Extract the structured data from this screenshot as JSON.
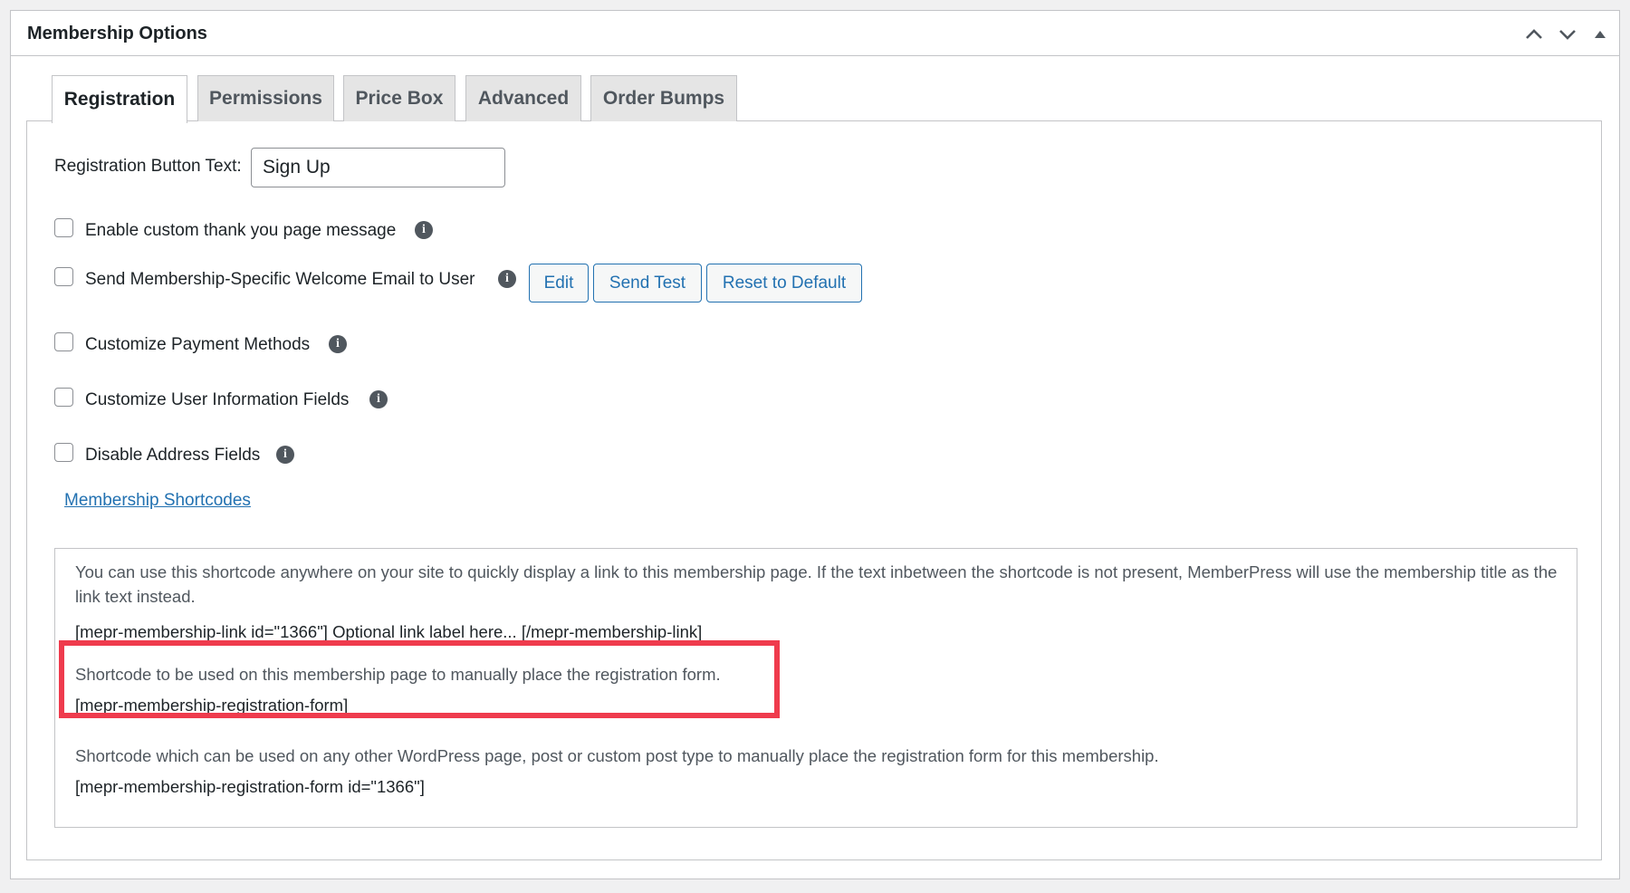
{
  "metabox": {
    "title": "Membership Options",
    "controls": [
      "chevron-up-icon",
      "chevron-down-icon",
      "triangle-up-icon"
    ]
  },
  "tabs": [
    {
      "label": "Registration",
      "active": true
    },
    {
      "label": "Permissions",
      "active": false
    },
    {
      "label": "Price Box",
      "active": false
    },
    {
      "label": "Advanced",
      "active": false
    },
    {
      "label": "Order Bumps",
      "active": false
    }
  ],
  "registration": {
    "button_text_label": "Registration Button Text:",
    "button_text_value": "Sign Up",
    "options": [
      {
        "label": "Enable custom thank you page message",
        "checked": false
      },
      {
        "label": "Send Membership-Specific Welcome Email to User",
        "checked": false
      },
      {
        "label": "Customize Payment Methods",
        "checked": false
      },
      {
        "label": "Customize User Information Fields",
        "checked": false
      },
      {
        "label": "Disable Address Fields",
        "checked": false
      }
    ],
    "email_buttons": {
      "edit": "Edit",
      "send_test": "Send Test",
      "reset": "Reset to Default"
    },
    "info_icon_glyph": "i",
    "shortcodes_link": "Membership Shortcodes"
  },
  "shortcodes": {
    "link_desc": "You can use this shortcode anywhere on your site to quickly display a link to this membership page. If the text inbetween the shortcode is not present, MemberPress will use the membership title as the link text instead.",
    "link_code": "[mepr-membership-link id=\"1366\"] Optional link label here... [/mepr-membership-link]",
    "page_desc": "Shortcode to be used on this membership page to manually place the registration form.",
    "page_code": "[mepr-membership-registration-form]",
    "other_desc": "Shortcode which can be used on any other WordPress page, post or custom post type to manually place the registration form for this membership.",
    "other_code": "[mepr-membership-registration-form id=\"1366\"]"
  },
  "colors": {
    "accent": "#2271b1",
    "highlight": "#ef3b4d",
    "border": "#c3c4c7"
  }
}
